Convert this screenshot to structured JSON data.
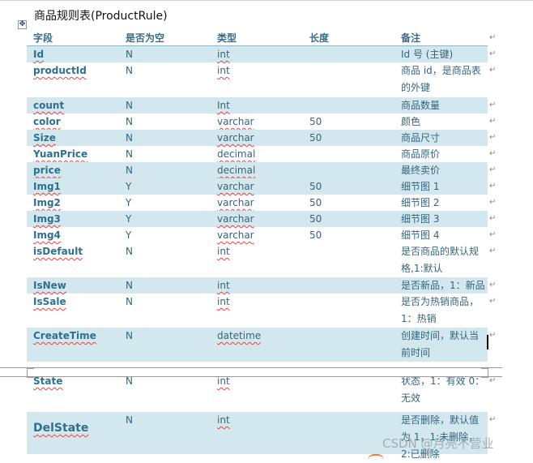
{
  "title": "商品规则表(ProductRule)",
  "marks": {
    "para": "↵",
    "handle": "✥"
  },
  "header": [
    "字段",
    "是否为空",
    "类型",
    "长度",
    "备注"
  ],
  "rows": [
    [
      "Id",
      "N",
      "int",
      "",
      "Id 号 (主键)"
    ],
    [
      "productId",
      "N",
      "int",
      "",
      "商品 id，是商品表的外键"
    ],
    [
      "count",
      "N",
      "Int",
      "",
      "商品数量"
    ],
    [
      "color",
      "N",
      "varchar",
      "50",
      "颜色"
    ],
    [
      "Size",
      "N",
      "varchar",
      "50",
      "商品尺寸"
    ],
    [
      "YuanPrice",
      "N",
      "decimal",
      "",
      "商品原价"
    ],
    [
      "price",
      "N",
      "decimal",
      "",
      "最终卖价"
    ],
    [
      "Img1",
      "Y",
      "varchar",
      "50",
      "细节图 1"
    ],
    [
      "Img2",
      "Y",
      "varchar",
      "50",
      "细节图 2"
    ],
    [
      "Img3",
      "Y",
      "varchar",
      "50",
      "细节图 3"
    ],
    [
      "Img4",
      "Y",
      "varchar",
      "50",
      "细节图 4"
    ],
    [
      "isDefault",
      "N",
      "int",
      "",
      "是否商品的默认规格,1:默认"
    ],
    [
      "IsNew",
      "N",
      "int",
      "",
      "是否新品，1：新品"
    ],
    [
      "IsSale",
      "N",
      "int",
      "",
      "是否为热销商品，1：热销"
    ],
    [
      "CreateTime",
      "N",
      "datetime",
      "",
      "创建时间，默认当前时间"
    ],
    [
      "State",
      "N",
      "int",
      "",
      "状态，1：有效 0：无效"
    ],
    [
      "DelState",
      "N",
      "int",
      "",
      "是否删除，默认值为 1，1:未删除，2:已删除"
    ]
  ],
  "watermark": "CSDN @月亮不营业",
  "colors": {
    "shade": "#d3e7ef",
    "text": "#36647a",
    "field": "#2f6f8f",
    "squiggle": "#e04848"
  }
}
